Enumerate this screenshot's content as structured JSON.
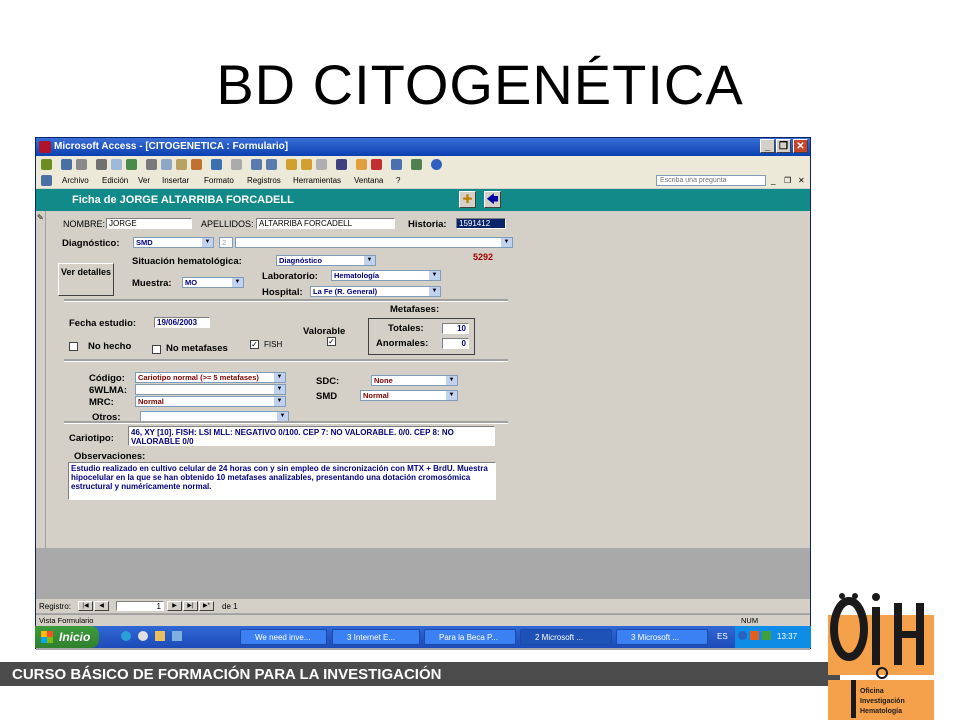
{
  "slide_title": "BD CITOGENÉTICA",
  "footer_text": "CURSO BÁSICO DE FORMACIÓN PARA LA INVESTIGACIÓN",
  "window": {
    "title": "Microsoft Access - [CITOGENETICA : Formulario]",
    "min": "_",
    "max": "❐",
    "close": "✕"
  },
  "menu": {
    "items": [
      "Archivo",
      "Edición",
      "Ver",
      "Insertar",
      "Formato",
      "Registros",
      "Herramientas",
      "Ventana",
      "?"
    ],
    "ask_placeholder": "Escriba una pregunta"
  },
  "form": {
    "header_title": "Ficha de JORGE ALTARRIBA FORCADELL",
    "nombre_label": "NOMBRE:",
    "nombre_value": "JORGE",
    "apellidos_label": "APELLIDOS:",
    "apellidos_value": "ALTARRIBA FORCADELL",
    "historia_label": "Historia:",
    "historia_value": "1591412",
    "diagnostico_label": "Diagnóstico:",
    "diagnostico_value": "SMD",
    "diagnostico_num": "2",
    "situacion_label": "Situación hematológica:",
    "situacion_value": "Diagnóstico",
    "code_5292": "5292",
    "ver_detalles": "Ver detalles",
    "muestra_label": "Muestra:",
    "muestra_value": "MO",
    "laboratorio_label": "Laboratorio:",
    "laboratorio_value": "Hematología",
    "hospital_label": "Hospital:",
    "hospital_value": "La Fe (R. General)",
    "metafases_label": "Metafases:",
    "fecha_label": "Fecha estudio:",
    "fecha_value": "19/06/2003",
    "valorable_label": "Valorable",
    "totales_label": "Totales:",
    "totales_value": "10",
    "anormales_label": "Anormales:",
    "anormales_value": "0",
    "no_hecho_label": "No hecho",
    "no_metafases_label": "No metafases",
    "fish_label": "FISH",
    "codigo_label": "Código:",
    "codigo_value": "Cariotipo normal (>= 5 metafases)",
    "swlma_label": "6WLMA:",
    "mrc_label": "MRC:",
    "mrc_value": "Normal",
    "otros_label": "Otros:",
    "sdc_label": "SDC:",
    "sdc_value": "None",
    "smd_label": "SMD",
    "smd_value": "Normal",
    "cariotipo_label": "Cariotipo:",
    "cariotipo_value": "46, XY [10]. FISH: LSI MLL: NEGATIVO 0/100. CEP 7: NO VALORABLE. 0/0. CEP 8: NO VALORABLE 0/0",
    "observaciones_label": "Observaciones:",
    "observaciones_value": "Estudio realizado en cultivo celular de 24 horas con y sin empleo de sincronización con MTX + BrdU. Muestra hipocelular en la que se han obtenido 10 metafases analizables, presentando una dotación cromosómica estructural y numéricamente normal."
  },
  "record_nav": {
    "label": "Registro:",
    "current": "1",
    "of": "de 1"
  },
  "status": {
    "left": "Vista Formulario",
    "right": "NUM"
  },
  "taskbar": {
    "start": "Inicio",
    "tasks": [
      "We need inve...",
      "3 Internet E...",
      "Para la Beca P...",
      "2 Microsoft ...",
      "3 Microsoft ..."
    ],
    "lang": "ES",
    "clock": "13:37"
  },
  "logo": {
    "letters": "OIH",
    "line1": "Oficina",
    "line2": "Investigación",
    "line3": "Hematología",
    "colors": {
      "orange": "#f5a04a",
      "dark": "#1a1a1a"
    }
  },
  "colors": {
    "form_header": "#138a8a",
    "titlebar": "#0a3fb0",
    "taskbar": "#1c4bb8",
    "band": "#4b4b4b"
  }
}
